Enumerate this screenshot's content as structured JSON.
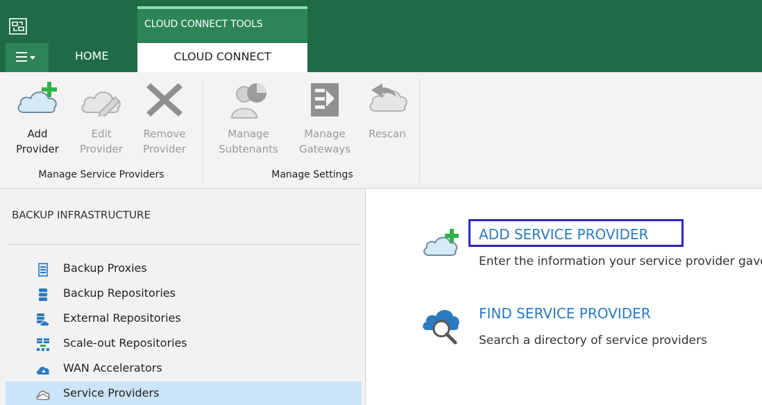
{
  "titlebar": {
    "contextual_tab_group": "CLOUD CONNECT TOOLS",
    "tabs": [
      {
        "label": "HOME"
      },
      {
        "label": "CLOUD CONNECT"
      }
    ]
  },
  "ribbon": {
    "groups": [
      {
        "label": "Manage Service Providers",
        "buttons": [
          {
            "line1": "Add",
            "line2": "Provider",
            "icon": "add-provider-icon",
            "enabled": true
          },
          {
            "line1": "Edit",
            "line2": "Provider",
            "icon": "edit-provider-icon",
            "enabled": false
          },
          {
            "line1": "Remove",
            "line2": "Provider",
            "icon": "remove-provider-icon",
            "enabled": false
          }
        ]
      },
      {
        "label": "Manage Settings",
        "buttons": [
          {
            "line1": "Manage",
            "line2": "Subtenants",
            "icon": "manage-subtenants-icon",
            "enabled": false
          },
          {
            "line1": "Manage",
            "line2": "Gateways",
            "icon": "manage-gateways-icon",
            "enabled": false
          },
          {
            "line1": "Rescan",
            "line2": "",
            "icon": "rescan-icon",
            "enabled": false
          }
        ]
      }
    ]
  },
  "nav": {
    "heading": "BACKUP INFRASTRUCTURE",
    "items": [
      {
        "label": "Backup Proxies",
        "icon": "backup-proxy-icon"
      },
      {
        "label": "Backup Repositories",
        "icon": "backup-repository-icon"
      },
      {
        "label": "External Repositories",
        "icon": "external-repository-icon"
      },
      {
        "label": "Scale-out Repositories",
        "icon": "scale-out-repository-icon"
      },
      {
        "label": "WAN Accelerators",
        "icon": "wan-accelerator-icon"
      },
      {
        "label": "Service Providers",
        "icon": "service-provider-icon",
        "selected": true
      }
    ]
  },
  "main": {
    "actions": [
      {
        "title": "ADD SERVICE PROVIDER",
        "description": "Enter the information your service provider gave you",
        "icon": "add-cloud-icon"
      },
      {
        "title": "FIND SERVICE PROVIDER",
        "description": "Search a directory of service providers",
        "icon": "find-cloud-icon"
      }
    ]
  },
  "colors": {
    "titlebar": "#1e6b45",
    "active_tab_group": "#2c8457",
    "link": "#2a7ac0",
    "highlight_box": "#2727c9",
    "selected_item": "#cce4f7"
  }
}
